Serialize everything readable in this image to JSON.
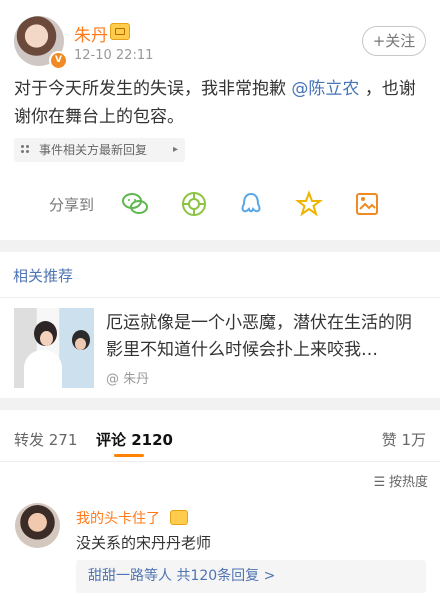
{
  "post": {
    "user_name": "朱丹",
    "avatar_badge": "V",
    "timestamp": "12-10 22:11",
    "follow_label": "+关注",
    "text_before": "对于今天所发生的失误，我非常抱歉",
    "mention": "@陈立农",
    "text_after": "，也谢谢你在舞台上的包容。",
    "event_label": "事件相关方最新回复",
    "event_arrow": "▸",
    "share_label": "分享到",
    "share_icons": [
      "wechat-icon",
      "moments-icon",
      "qq-icon",
      "favorite-icon",
      "image-icon"
    ]
  },
  "related": {
    "title": "相关推荐",
    "text": "厄运就像是一个小恶魔，潜伏在生活的阴影里不知道什么时候会扑上来咬我…",
    "author": "@ 朱丹"
  },
  "tabs": {
    "repost": "转发 271",
    "comment": "评论 2120",
    "like": "赞 1万",
    "sort": "按热度"
  },
  "comment": {
    "name": "我的头卡住了",
    "text": "没关系的宋丹丹老师",
    "replies": "甜甜一路等人 共120条回复 >"
  },
  "colors": {
    "accent_orange": "#ff7a1a",
    "link_blue": "#4f74b3",
    "tab_indicator": "#ff8200"
  }
}
